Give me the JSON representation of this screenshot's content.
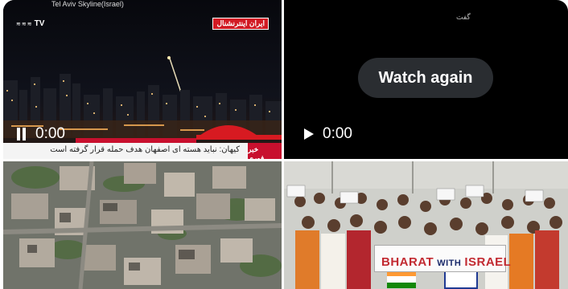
{
  "tiles": {
    "top_left": {
      "caption": "Tel Aviv Skyline(Israel)",
      "channel_logo": "TV",
      "network_label": "ایران اینترنشنال",
      "ticker_text": "کیهان: نباید هسته ای اصفهان هدف حمله قرار گرفته است",
      "ticker_tag": "خبر فوری",
      "time": "0:00",
      "pause_icon": "pause-icon"
    },
    "top_right": {
      "tag": "گفت",
      "watch_again_label": "Watch again",
      "time": "0:00",
      "play_icon": "play-icon"
    },
    "bottom_left": {
      "description": "aerial-damaged-houses"
    },
    "bottom_right": {
      "banner_bharat": "BHARAT",
      "banner_with": "WITH",
      "banner_israel": "ISRAEL"
    }
  },
  "colors": {
    "dark_bg": "#0b0c12",
    "pill_bg": "#2a2d31",
    "news_red": "#c8102e",
    "banner_red": "#c22a31",
    "banner_blue": "#1a2a6a"
  }
}
